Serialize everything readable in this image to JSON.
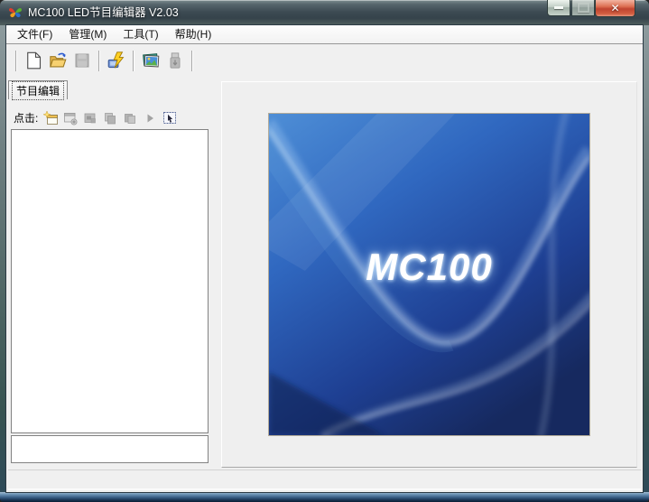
{
  "window": {
    "title": "MC100 LED节目编辑器 V2.03",
    "controls": {
      "minimize_icon": "minimize-icon",
      "maximize_icon": "maximize-icon",
      "close_icon": "close-icon"
    }
  },
  "menu": {
    "items": [
      {
        "label": "文件(F)"
      },
      {
        "label": "管理(M)"
      },
      {
        "label": "工具(T)"
      },
      {
        "label": "帮助(H)"
      }
    ]
  },
  "toolbar": {
    "buttons": [
      {
        "icon": "new-document-icon",
        "enabled": true
      },
      {
        "icon": "open-folder-icon",
        "enabled": true
      },
      {
        "icon": "save-icon",
        "enabled": false
      },
      {
        "icon": "send-lightning-icon",
        "enabled": true
      },
      {
        "icon": "pictures-icon",
        "enabled": true
      },
      {
        "icon": "usb-download-icon",
        "enabled": false
      }
    ]
  },
  "sidebar": {
    "tab_label": "节目编辑",
    "hint_label": "点击:",
    "tool_icons": [
      {
        "icon": "new-program-icon",
        "enabled": true
      },
      {
        "icon": "add-item-icon",
        "enabled": false
      },
      {
        "icon": "edit-item-icon",
        "enabled": false
      },
      {
        "icon": "copy-item-icon",
        "enabled": false
      },
      {
        "icon": "paste-item-icon",
        "enabled": false
      },
      {
        "icon": "play-icon",
        "enabled": false
      },
      {
        "icon": "preview-icon",
        "enabled": true
      }
    ],
    "program_list_items": []
  },
  "preview": {
    "watermark": "MC100"
  },
  "colors": {
    "titlebar": "#3c4a52",
    "close_button": "#c04430",
    "client_bg": "#f0f0f0",
    "image_blue_mid": "#3068c0",
    "image_blue_dark": "#16295f",
    "frame_bottom_blue": "#375b82"
  }
}
